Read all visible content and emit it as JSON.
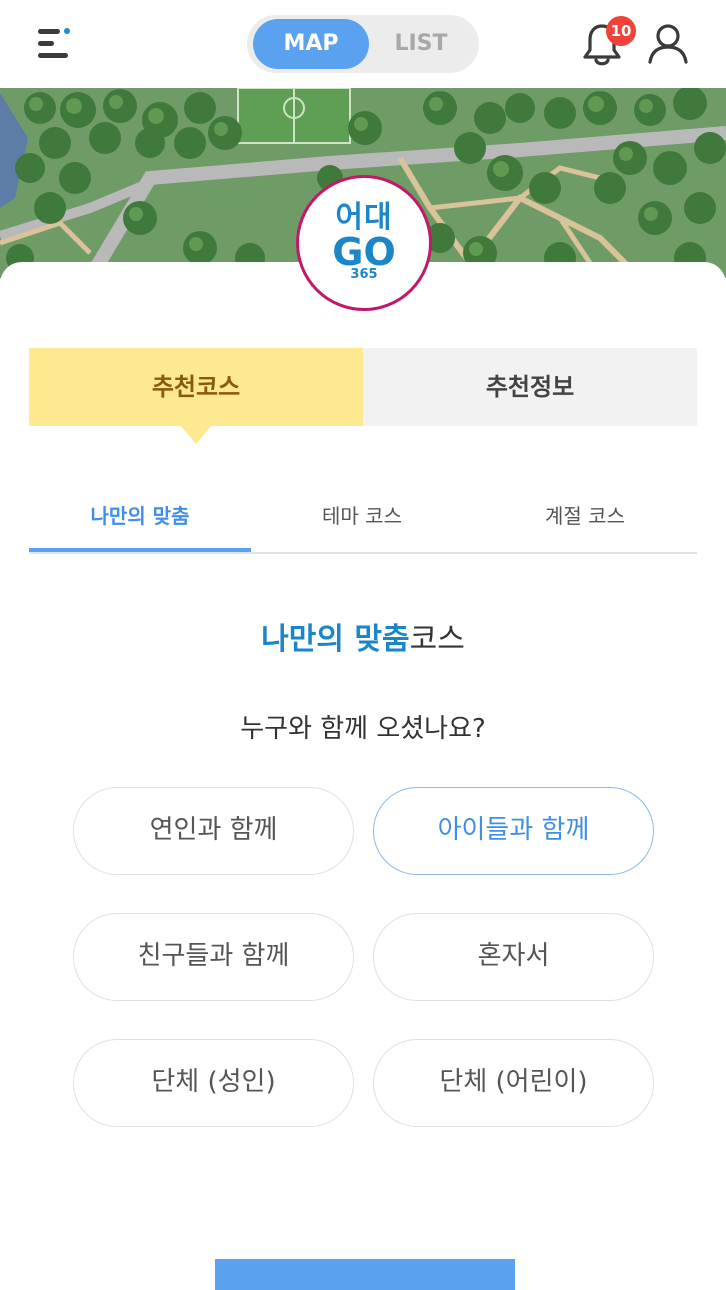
{
  "header": {
    "view_toggle": {
      "map_label": "MAP",
      "list_label": "LIST",
      "selected": "MAP"
    },
    "notifications": {
      "count": "10"
    }
  },
  "colors": {
    "accent_blue": "#5aa2ef",
    "title_blue": "#1a86c9",
    "tab_yellow": "#fde98f",
    "badge_red": "#f0423a",
    "logo_ring": "#c2186b"
  },
  "logo": {
    "line1": "어대",
    "line2": "GO",
    "line3": "365"
  },
  "main_tabs": [
    {
      "label": "추천코스",
      "active": true
    },
    {
      "label": "추천정보",
      "active": false
    }
  ],
  "sub_tabs": [
    {
      "label": "나만의 맞춤",
      "active": true
    },
    {
      "label": "테마 코스",
      "active": false
    },
    {
      "label": "계절 코스",
      "active": false
    }
  ],
  "course": {
    "title_highlight": "나만의 맞춤",
    "title_rest": "코스",
    "question": "누구와 함께 오셨나요?"
  },
  "options": [
    {
      "label": "연인과 함께",
      "selected": false
    },
    {
      "label": "아이들과 함께",
      "selected": true
    },
    {
      "label": "친구들과 함께",
      "selected": false
    },
    {
      "label": "혼자서",
      "selected": false
    },
    {
      "label": "단체 (성인)",
      "selected": false
    },
    {
      "label": "단체 (어린이)",
      "selected": false
    }
  ],
  "icons": [
    "menu-icon",
    "bell-icon",
    "user-icon"
  ]
}
